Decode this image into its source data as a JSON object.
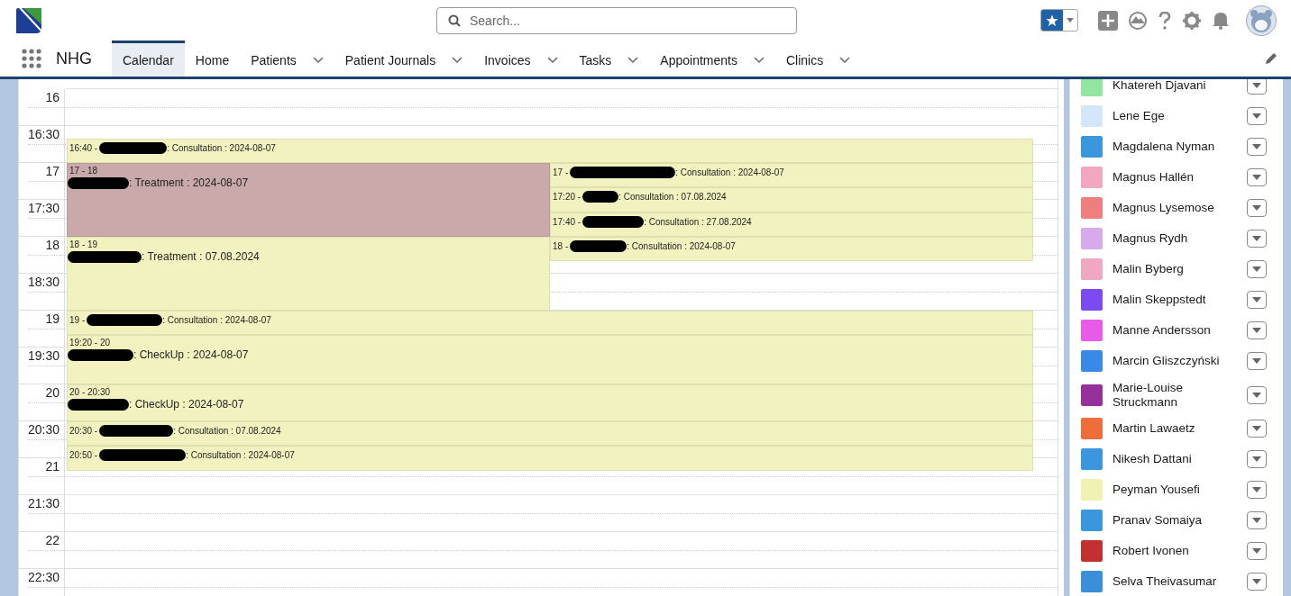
{
  "header": {
    "search": {
      "placeholder": "Search..."
    }
  },
  "nav": {
    "app_name": "NHG",
    "tabs": [
      {
        "label": "Calendar",
        "selected": true,
        "has_menu": false
      },
      {
        "label": "Home",
        "selected": false,
        "has_menu": false
      },
      {
        "label": "Patients",
        "selected": false,
        "has_menu": true
      },
      {
        "label": "Patient Journals",
        "selected": false,
        "has_menu": true
      },
      {
        "label": "Invoices",
        "selected": false,
        "has_menu": true
      },
      {
        "label": "Tasks",
        "selected": false,
        "has_menu": true
      },
      {
        "label": "Appointments",
        "selected": false,
        "has_menu": true
      },
      {
        "label": "Clinics",
        "selected": false,
        "has_menu": true
      }
    ]
  },
  "calendar": {
    "time_labels": [
      "16",
      "16:30",
      "17",
      "17:30",
      "18",
      "18:30",
      "19",
      "19:30",
      "20",
      "20:30",
      "21",
      "21:30",
      "22",
      "22:30"
    ],
    "events": [
      {
        "kind": "short",
        "time": "16:40 -",
        "title": ": Consultation : 2024-08-07",
        "color": "#f2f2c0"
      },
      {
        "kind": "long",
        "time": "17 - 18",
        "title": ": Treatment : 2024-08-07",
        "color": "#c9a9a9"
      },
      {
        "kind": "short",
        "time": "17 -",
        "title": ": Consultation : 2024-08-07",
        "color": "#f2f2c0"
      },
      {
        "kind": "short",
        "time": "17:20 -",
        "title": ": Consultation : 07.08.2024",
        "color": "#f2f2c0"
      },
      {
        "kind": "short",
        "time": "17:40 -",
        "title": ": Consultation : 27.08.2024",
        "color": "#f2f2c0"
      },
      {
        "kind": "long",
        "time": "18 - 19",
        "title": ": Treatment : 07.08.2024",
        "color": "#f2f2c0"
      },
      {
        "kind": "short",
        "time": "18 -",
        "title": ": Consultation : 2024-08-07",
        "color": "#f2f2c0"
      },
      {
        "kind": "short",
        "time": "19 -",
        "title": ": Consultation : 2024-08-07",
        "color": "#f2f2c0"
      },
      {
        "kind": "long",
        "time": "19:20 - 20",
        "title": ": CheckUp : 2024-08-07",
        "color": "#f2f2c0"
      },
      {
        "kind": "long",
        "time": "20 - 20:30",
        "title": ": CheckUp : 2024-08-07",
        "color": "#f2f2c0"
      },
      {
        "kind": "short",
        "time": "20:30 -",
        "title": ": Consultation : 07.08.2024",
        "color": "#f2f2c0"
      },
      {
        "kind": "short",
        "time": "20:50 -",
        "title": ": Consultation : 2024-08-07",
        "color": "#f2f2c0"
      }
    ]
  },
  "calendars": [
    {
      "name": "Khatereh Djavani",
      "color": "#93e6a1"
    },
    {
      "name": "Lene Ege",
      "color": "#d4e6f9"
    },
    {
      "name": "Magdalena Nyman",
      "color": "#3b97dc"
    },
    {
      "name": "Magnus Hallén",
      "color": "#f2a6c0"
    },
    {
      "name": "Magnus Lysemose",
      "color": "#ef7f7f"
    },
    {
      "name": "Magnus Rydh",
      "color": "#d7aaee"
    },
    {
      "name": "Malin Byberg",
      "color": "#f0a7c1"
    },
    {
      "name": "Malin Skeppstedt",
      "color": "#7b4af0"
    },
    {
      "name": "Manne Andersson",
      "color": "#e85ae8"
    },
    {
      "name": "Marcin Gliszczyński",
      "color": "#3a88e8"
    },
    {
      "name": "Marie-Louise Struckmann",
      "color": "#96309a"
    },
    {
      "name": "Martin Lawaetz",
      "color": "#ee6d3a"
    },
    {
      "name": "Nikesh Dattani",
      "color": "#3a97dd"
    },
    {
      "name": "Peyman Yousefi",
      "color": "#f1f1b3"
    },
    {
      "name": "Pranav Somaiya",
      "color": "#3a97db"
    },
    {
      "name": "Robert Ivonen",
      "color": "#c2302f"
    },
    {
      "name": "Selva Theivasumar",
      "color": "#3a8fd8"
    }
  ]
}
